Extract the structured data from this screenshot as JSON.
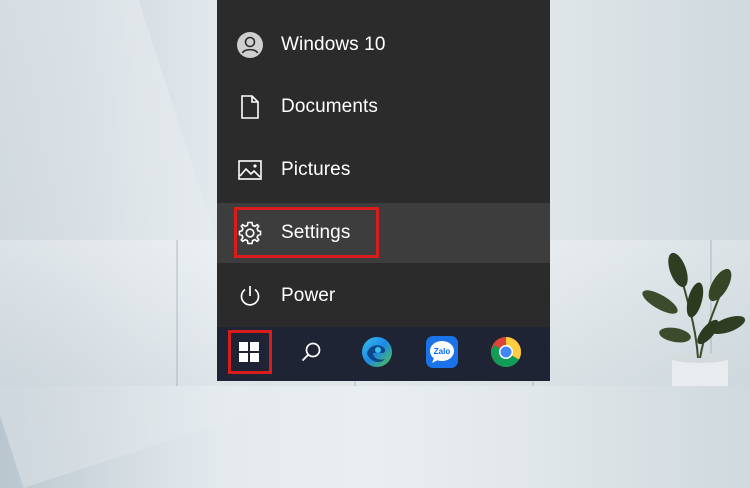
{
  "start_menu": {
    "items": [
      {
        "label": "Windows 10",
        "icon": "user-icon"
      },
      {
        "label": "Documents",
        "icon": "document-icon"
      },
      {
        "label": "Pictures",
        "icon": "pictures-icon"
      },
      {
        "label": "Settings",
        "icon": "gear-icon"
      },
      {
        "label": "Power",
        "icon": "power-icon"
      }
    ],
    "hovered_item": "Settings",
    "highlight_color": "#d81d1d"
  },
  "taskbar": {
    "buttons": [
      {
        "icon": "windows-start-icon"
      },
      {
        "icon": "search-icon"
      },
      {
        "icon": "edge-icon"
      },
      {
        "icon": "zalo-icon",
        "text": "Zalo"
      },
      {
        "icon": "chrome-icon"
      }
    ]
  },
  "colors": {
    "menu_background": "#2b2b2b",
    "taskbar_background": "#1e2433",
    "hover_background": "#3d3d3d"
  }
}
